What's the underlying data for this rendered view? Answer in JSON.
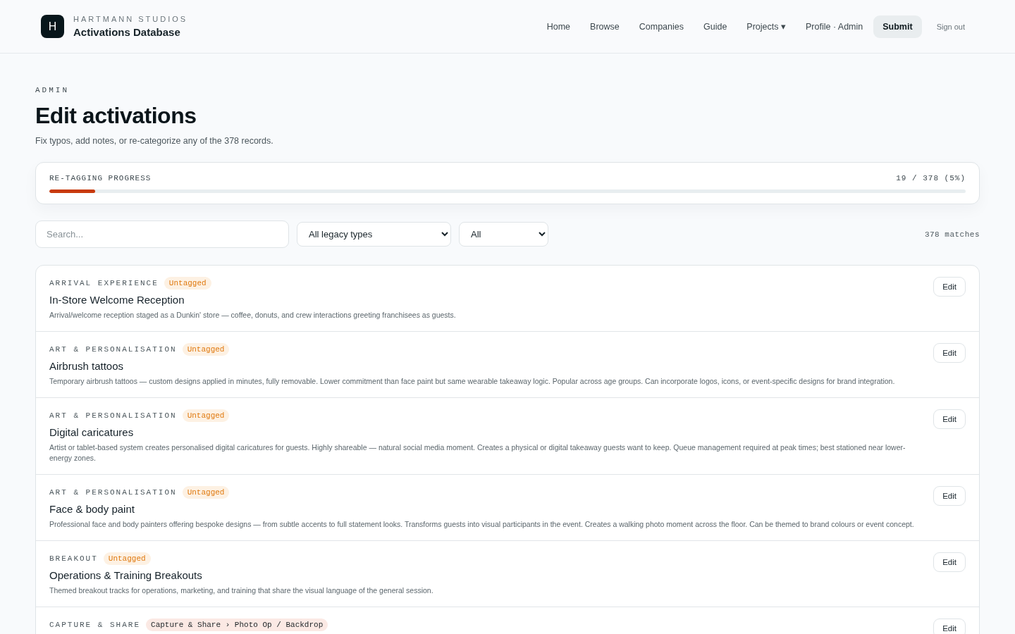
{
  "brand": {
    "logo_letter": "H",
    "studio": "HARTMANN STUDIOS",
    "title": "Activations Database"
  },
  "nav": [
    {
      "label": "Home",
      "kind": "link",
      "selected": false
    },
    {
      "label": "Browse",
      "kind": "link",
      "selected": false
    },
    {
      "label": "Companies",
      "kind": "link",
      "selected": false
    },
    {
      "label": "Guide",
      "kind": "link",
      "selected": false
    },
    {
      "label": "Projects ▾",
      "kind": "link",
      "selected": false
    },
    {
      "label": "Profile · Admin",
      "kind": "link",
      "selected": false
    },
    {
      "label": "Submit",
      "kind": "link",
      "selected": true
    },
    {
      "label": "Sign out",
      "kind": "small",
      "selected": false
    }
  ],
  "eyebrow": "ADMIN",
  "heading": "Edit activations",
  "subtitle": "Fix typos, add notes, or re-categorize any of the 378 records.",
  "progress": {
    "label": "RE-TAGGING PROGRESS",
    "reading": "19 / 378 (5%)",
    "level": 0.05
  },
  "filters": {
    "search_placeholder": "Search...",
    "type_select": "All legacy types",
    "status_select": "All",
    "matches": "378 matches"
  },
  "records": [
    {
      "category": "ARRIVAL EXPERIENCE",
      "tag": {
        "kind": "untagged",
        "text": "Untagged"
      },
      "title": "In-Store Welcome Reception",
      "description": "Arrival/welcome reception staged as a Dunkin' store — coffee, donuts, and crew interactions greeting franchisees as guests.",
      "button": "Edit"
    },
    {
      "category": "ART & PERSONALISATION",
      "tag": {
        "kind": "untagged",
        "text": "Untagged"
      },
      "title": "Airbrush tattoos",
      "description": "Temporary airbrush tattoos — custom designs applied in minutes, fully removable. Lower commitment than face paint but same wearable takeaway logic. Popular across age groups. Can incorporate logos, icons, or event-specific designs for brand integration.",
      "button": "Edit"
    },
    {
      "category": "ART & PERSONALISATION",
      "tag": {
        "kind": "untagged",
        "text": "Untagged"
      },
      "title": "Digital caricatures",
      "description": "Artist or tablet-based system creates personalised digital caricatures for guests. Highly shareable — natural social media moment. Creates a physical or digital takeaway guests want to keep. Queue management required at peak times; best stationed near lower-energy zones.",
      "button": "Edit"
    },
    {
      "category": "ART & PERSONALISATION",
      "tag": {
        "kind": "untagged",
        "text": "Untagged"
      },
      "title": "Face & body paint",
      "description": "Professional face and body painters offering bespoke designs — from subtle accents to full statement looks. Transforms guests into visual participants in the event. Creates a walking photo moment across the floor. Can be themed to brand colours or event concept.",
      "button": "Edit"
    },
    {
      "category": "BREAKOUT",
      "tag": {
        "kind": "untagged",
        "text": "Untagged"
      },
      "title": "Operations & Training Breakouts",
      "description": "Themed breakout tracks for operations, marketing, and training that share the visual language of the general session.",
      "button": "Edit"
    },
    {
      "category": "CAPTURE & SHARE",
      "tag": {
        "kind": "tagged",
        "text": "Capture & Share › Photo Op / Backdrop"
      },
      "button": "Edit"
    }
  ]
}
